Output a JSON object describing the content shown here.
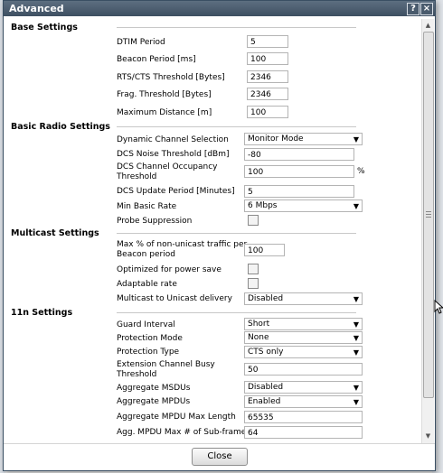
{
  "dialog": {
    "title": "Advanced",
    "help_label": "?",
    "close_label": "×",
    "close_button": "Close"
  },
  "base": {
    "title": "Base Settings",
    "dtim_label": "DTIM Period",
    "dtim_value": "5",
    "beacon_label": "Beacon Period [ms]",
    "beacon_value": "100",
    "rts_label": "RTS/CTS Threshold [Bytes]",
    "rts_value": "2346",
    "frag_label": "Frag. Threshold [Bytes]",
    "frag_value": "2346",
    "maxdist_label": "Maximum Distance [m]",
    "maxdist_value": "100"
  },
  "radio": {
    "title": "Basic Radio Settings",
    "dcs_label": "Dynamic Channel Selection",
    "dcs_value": "Monitor Mode",
    "noise_label": "DCS Noise Threshold [dBm]",
    "noise_value": "-80",
    "occupancy_label_1": "DCS Channel Occupancy",
    "occupancy_label_2": "Threshold",
    "occupancy_value": "100",
    "occupancy_unit": "%",
    "update_label": "DCS Update Period [Minutes]",
    "update_value": "5",
    "minrate_label": "Min Basic Rate",
    "minrate_value": "6 Mbps",
    "probe_label": "Probe Suppression"
  },
  "multicast": {
    "title": "Multicast Settings",
    "nonunicast_label_1": "Max % of non-unicast traffic per",
    "nonunicast_label_2": "Beacon period",
    "nonunicast_value": "100",
    "powersave_label": "Optimized for power save",
    "adaptable_label": "Adaptable rate",
    "m2u_label": "Multicast to Unicast delivery",
    "m2u_value": "Disabled"
  },
  "n11": {
    "title": "11n Settings",
    "guard_label": "Guard Interval",
    "guard_value": "Short",
    "protmode_label": "Protection Mode",
    "protmode_value": "None",
    "prottype_label": "Protection Type",
    "prottype_value": "CTS only",
    "busy_label_1": "Extension Channel Busy",
    "busy_label_2": "Threshold",
    "busy_value": "50",
    "msdu_label": "Aggregate MSDUs",
    "msdu_value": "Disabled",
    "mpdu_label": "Aggregate MPDUs",
    "mpdu_value": "Enabled",
    "mpdulen_label": "Aggregate MPDU Max Length",
    "mpdulen_value": "65535",
    "subframes_label": "Agg. MPDU Max # of Sub-frames",
    "subframes_value": "64"
  },
  "icons": {
    "dropdown": "chevron-down-icon",
    "scroll_up": "scroll-up-icon",
    "scroll_down": "scroll-down-icon",
    "cursor": "mouse-cursor-icon"
  },
  "colors": {
    "titlebar": "#4a5b6d",
    "border": "#3a4f63"
  }
}
